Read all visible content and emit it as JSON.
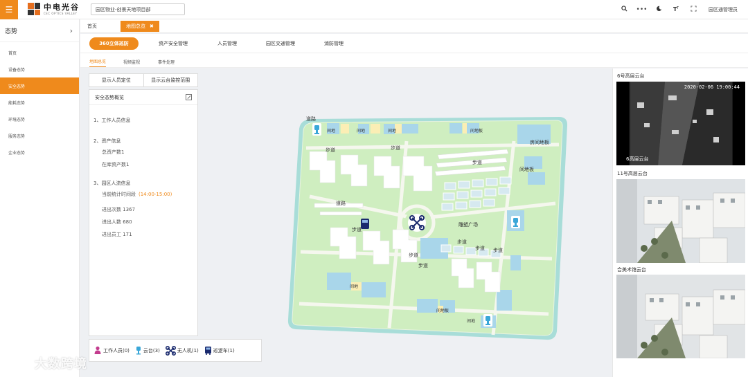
{
  "header": {
    "logo_text": "中电光谷",
    "logo_sub": "CEC OPTICS VALLEY",
    "project": "园区物业-创景天地项目部",
    "user": "园区通管理员"
  },
  "sidebar": {
    "title": "态势",
    "items": [
      {
        "label": "首页"
      },
      {
        "label": "设备态势"
      },
      {
        "label": "安全态势"
      },
      {
        "label": "能耗态势"
      },
      {
        "label": "环境态势"
      },
      {
        "label": "服务态势"
      },
      {
        "label": "企业态势"
      }
    ]
  },
  "tabs": {
    "home": "首页",
    "active": "地图总览"
  },
  "nav": {
    "items": [
      {
        "label": "360立体巡防"
      },
      {
        "label": "资产安全管理"
      },
      {
        "label": "人员管理"
      },
      {
        "label": "园区交通管理"
      },
      {
        "label": "消防管理"
      }
    ]
  },
  "subnav": {
    "items": [
      {
        "label": "地图总览"
      },
      {
        "label": "视频监视"
      },
      {
        "label": "事件处理"
      }
    ]
  },
  "buttons": {
    "show_people": "显示人员定位",
    "show_ptz": "显示云台监控范围"
  },
  "overview": {
    "title": "安全态势概览",
    "sec1": "1、工作人员信息",
    "sec2": "2、资产信息",
    "total_assets": "总资产数1",
    "in_stock": "在库资产数1",
    "sec3": "3、园区人流信息",
    "period_label": "当前统计时间段",
    "period_value": "(14:00-15:00)",
    "in_out": "进出次数 1367",
    "in_out_people": "进出人数 680",
    "in_out_staff": "进出员工 171"
  },
  "legend": {
    "staff": "工作人员(0)",
    "ptz": "云台(3)",
    "drone": "无人机(1)",
    "patrol": "巡逻车(1)"
  },
  "map_labels": {
    "road": "道路",
    "walk": "步道",
    "plaza": "雕塑广场",
    "room": "间地",
    "room_b": "间地板",
    "room_c": "房间地板",
    "room_d": "房间地板",
    "room_e": "间地板",
    "room_f": "间地",
    "room_g": "间地板",
    "room_h": "间地"
  },
  "cameras": [
    {
      "title": "6号高层云台",
      "time": "2020-02-06 19:00:44",
      "label": "6高层云台"
    },
    {
      "title": "11号高层云台"
    },
    {
      "title": "合美术馆云台"
    }
  ],
  "watermark": "大数跨境",
  "colors": {
    "accent": "#ef8a1c",
    "map_green": "#cfeec0",
    "map_border": "#a8ddd8",
    "building": "#ffffff",
    "water": "#a9d6ea"
  }
}
